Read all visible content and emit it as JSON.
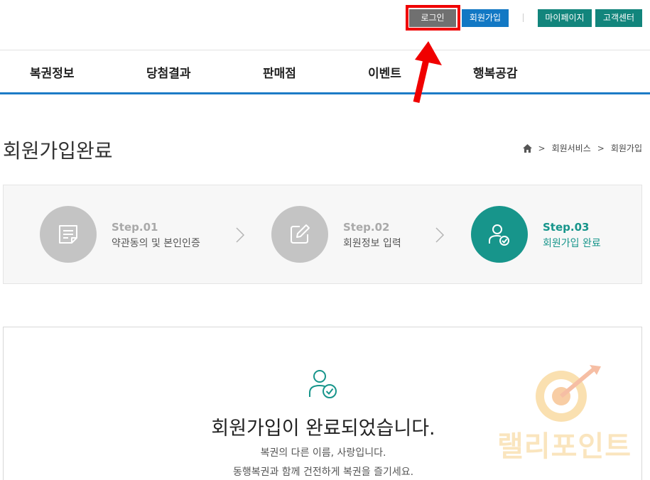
{
  "header": {
    "login_label": "로그인",
    "join_label": "회원가입",
    "mypage_label": "마이페이지",
    "cs_label": "고객센터"
  },
  "gnb": {
    "items": [
      {
        "label": "복권정보"
      },
      {
        "label": "당첨결과"
      },
      {
        "label": "판매점"
      },
      {
        "label": "이벤트"
      },
      {
        "label": "행복공감"
      }
    ]
  },
  "page": {
    "title": "회원가입완료",
    "breadcrumb": [
      "회원서비스",
      "회원가입"
    ]
  },
  "steps": [
    {
      "num": "Step.01",
      "desc": "약관동의 및 본인인증",
      "icon": "document-icon",
      "active": false
    },
    {
      "num": "Step.02",
      "desc": "회원정보 입력",
      "icon": "edit-icon",
      "active": false
    },
    {
      "num": "Step.03",
      "desc": "회원가입 완료",
      "icon": "user-check-icon",
      "active": true
    }
  ],
  "result": {
    "icon": "user-check-icon",
    "title": "회원가입이 완료되었습니다.",
    "line1": "복권의 다른 이름, 사랑입니다.",
    "line2": "동행복권과 함께 건전하게 복권을 즐기세요."
  },
  "watermark": {
    "text": "랠리포인트"
  },
  "colors": {
    "primary_blue": "#1278c4",
    "teal": "#17958b",
    "login_gray": "#707070",
    "highlight_red": "#f00000"
  }
}
